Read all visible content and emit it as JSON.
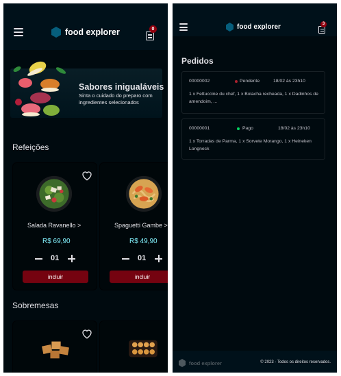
{
  "brand": {
    "name": "food explorer",
    "accent": "#065e7c"
  },
  "header": {
    "order_count": "0",
    "order_count_right": "3"
  },
  "banner": {
    "title": "Sabores inigualáveis",
    "subtitle": "Sinta o cuidado do preparo com ingredientes selecionados"
  },
  "sections": [
    {
      "title": "Refeições",
      "dishes": [
        {
          "name": "Salada Ravanello >",
          "price": "R$ 69,90",
          "quantity": "01",
          "button": "incluir"
        },
        {
          "name": "Spaguetti Gambe >",
          "price": "R$ 49,90",
          "quantity": "01",
          "button": "incluir"
        }
      ]
    },
    {
      "title": "Sobremesas"
    }
  ],
  "orders_page": {
    "title": "Pedidos",
    "orders": [
      {
        "code": "00000002",
        "status": "Pendente",
        "status_color": "#ab222e",
        "date": "18/02 às 23h10",
        "items": "1 x Fettuccine du chef, 1 x Bolacha recheada, 1 x Dadinhos de amendoim, ..."
      },
      {
        "code": "00000001",
        "status": "Pago",
        "status_color": "#04d361",
        "date": "18/02 às 23h10",
        "items": "1 x Torradas de Parma, 1 x Sorvete Morango, 1 x Heineken Longneck"
      }
    ]
  },
  "footer": {
    "brand": "food explorer",
    "copyright": "© 2023 - Todos os direitos reservados."
  }
}
